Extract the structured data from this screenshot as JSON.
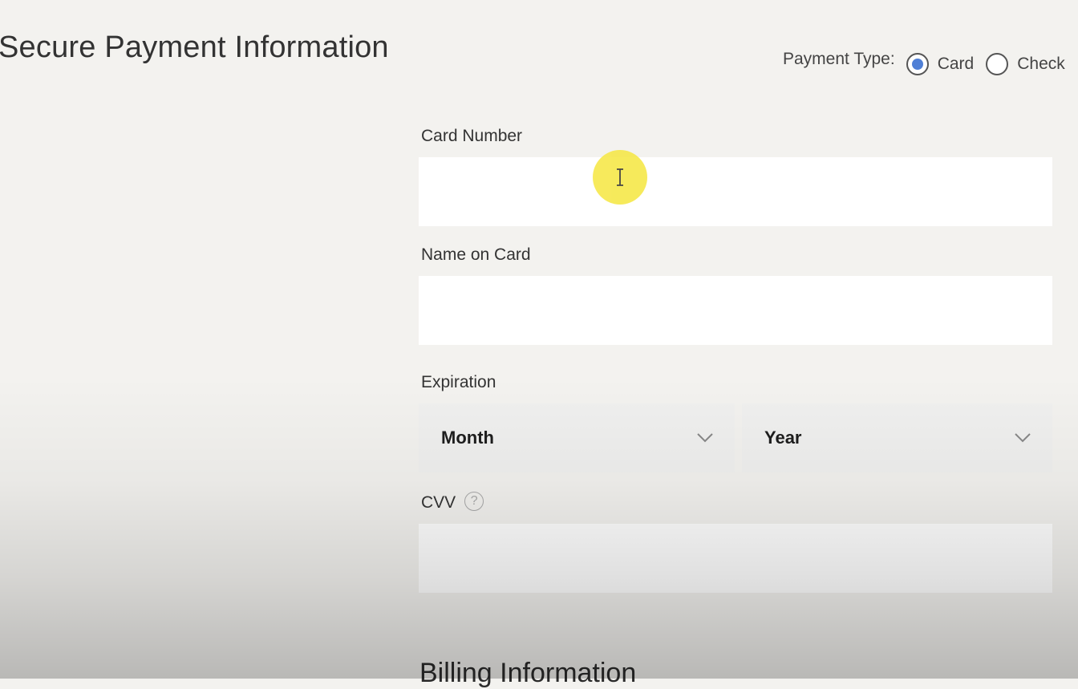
{
  "header": {
    "title": "Secure Payment Information"
  },
  "payment_type": {
    "label": "Payment Type:",
    "options": [
      {
        "label": "Card",
        "selected": true
      },
      {
        "label": "Check",
        "selected": false
      }
    ],
    "accent_color": "#4f7fd6"
  },
  "form": {
    "card_number": {
      "label": "Card Number",
      "value": "",
      "placeholder": ""
    },
    "name_on_card": {
      "label": "Name on Card",
      "value": "",
      "placeholder": ""
    },
    "expiration": {
      "label": "Expiration",
      "month": {
        "selected": "Month"
      },
      "year": {
        "selected": "Year"
      }
    },
    "cvv": {
      "label": "CVV",
      "value": "",
      "placeholder": ""
    }
  },
  "billing": {
    "heading": "Billing Information"
  },
  "icons": {
    "cursor": "text-cursor-icon",
    "radio": "radio-icon",
    "chevron": "chevron-down-icon",
    "help": "help-circle-icon"
  },
  "colors": {
    "background": "#f3f2ef",
    "input_background": "#ffffff",
    "select_background": "#f0f0ef",
    "cursor_highlight": "#f6e84a"
  }
}
